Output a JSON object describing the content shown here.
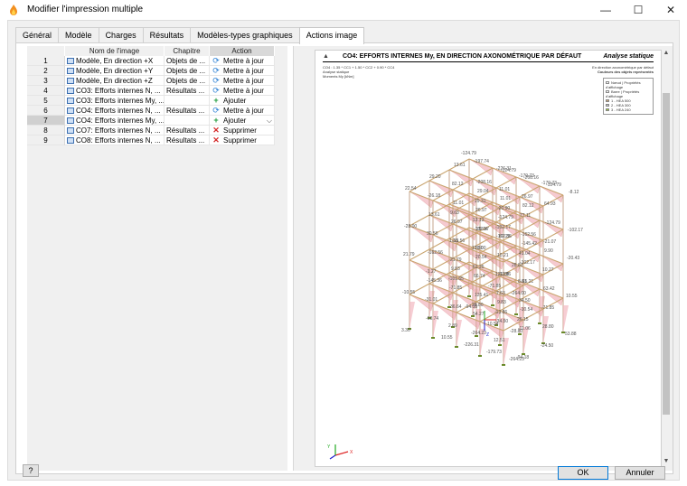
{
  "window": {
    "title": "Modifier l'impression multiple",
    "minimize": "—",
    "maximize": "☐",
    "close": "✕"
  },
  "tabs": [
    {
      "label": "Général"
    },
    {
      "label": "Modèle"
    },
    {
      "label": "Charges"
    },
    {
      "label": "Résultats"
    },
    {
      "label": "Modèles-types graphiques"
    },
    {
      "label": "Actions image"
    }
  ],
  "active_tab": "Actions image",
  "table": {
    "headers": {
      "num": "",
      "name": "Nom de l'image",
      "chapter": "Chapitre",
      "action": "Action"
    },
    "rows": [
      {
        "num": "1",
        "name": "Modèle, En direction +X",
        "chapter": "Objets de ...",
        "action": "Mettre à jour",
        "icon": "refresh-icon"
      },
      {
        "num": "2",
        "name": "Modèle, En direction +Y",
        "chapter": "Objets de ...",
        "action": "Mettre à jour",
        "icon": "refresh-icon"
      },
      {
        "num": "3",
        "name": "Modèle, En direction +Z",
        "chapter": "Objets de ...",
        "action": "Mettre à jour",
        "icon": "refresh-icon"
      },
      {
        "num": "4",
        "name": "CO3: Efforts internes N, ...",
        "chapter": "Résultats ...",
        "action": "Mettre à jour",
        "icon": "refresh-icon"
      },
      {
        "num": "5",
        "name": "CO3: Efforts internes My, ...",
        "chapter": "",
        "action": "Ajouter",
        "icon": "add-icon"
      },
      {
        "num": "6",
        "name": "CO4: Efforts internes N, ...",
        "chapter": "Résultats ...",
        "action": "Mettre à jour",
        "icon": "refresh-icon"
      },
      {
        "num": "7",
        "name": "CO4: Efforts internes My, ...",
        "chapter": "",
        "action": "Ajouter",
        "icon": "add-icon"
      },
      {
        "num": "8",
        "name": "CO7: Efforts internes N, ...",
        "chapter": "Résultats ...",
        "action": "Supprimer",
        "icon": "delete-icon"
      },
      {
        "num": "9",
        "name": "CO8: Efforts internes N, ...",
        "chapter": "Résultats ...",
        "action": "Supprimer",
        "icon": "delete-icon"
      }
    ],
    "selected_row": "7"
  },
  "preview": {
    "title": "CO4: EFFORTS INTERNES My, EN DIRECTION AXONOMÉTRIQUE PAR DÉFAUT",
    "analysis": "Analyse statique",
    "info": [
      "CO4 : 1.35 * CC1 + 1.50 * CC2 + 0.90 * CC4",
      "Analyse statique",
      "Moments My [kNm]"
    ],
    "direction": [
      "En direction axonométrique par défaut",
      "Couleurs des objets représentés"
    ],
    "legend": [
      {
        "label": "Nœud | Propriétés d'affichage",
        "color": "#ffffff"
      },
      {
        "label": "Barre | Propriétés d'affichage",
        "color": "#ffffff"
      },
      {
        "label": "1 - HEA 500",
        "color": "#c8a070"
      },
      {
        "label": "2 - HEA 300",
        "color": "#c0c0c0"
      },
      {
        "label": "3 - HEA 240",
        "color": "#9acd32"
      }
    ],
    "value_labels": [
      "-124.79",
      "-124.79",
      "-208.16",
      "-124.79",
      "-8.12",
      "13.61",
      "-208.16",
      "11.01",
      "26.97",
      "64.93",
      "29.20",
      "82.12",
      "29.31",
      "-20.90",
      "77.11",
      "22.54",
      "-26.18",
      "9.63",
      "13.13",
      "-102.17",
      "29.04",
      "11.01",
      "82.12",
      "-124.79",
      "-102.17",
      "11.01",
      "26.97",
      "-124.79",
      "-162.56",
      "-21.07",
      "13.61",
      "26.97",
      "-102.17",
      "-162.56",
      "41.04",
      "-28.00",
      "30.56",
      "1.35",
      "17.30",
      "28.81",
      "29.04",
      "67.25",
      "-145.42",
      "9.90",
      "-20.43",
      "-13.56",
      "28.00",
      "10.21",
      "-102.17",
      "10.27",
      "-162.56",
      "21.79",
      "61.25",
      "121.08",
      "8.91",
      "21.79",
      "-1.27",
      "-101.65",
      "-71.85",
      "-264.00",
      "20.54",
      "-13.86",
      "-65.21",
      "63.42",
      "10.55",
      "9.83",
      "66.74",
      "7.63",
      "34.50",
      "-71.85",
      "-145.36",
      "-71.85",
      "28.80",
      "-13.86",
      "26.15",
      "-10.55",
      "-31.01",
      "-94.18",
      "10.54",
      "-28.80",
      "125.41",
      "9.83",
      "-10.54",
      "28.80",
      "53.88",
      "36.64",
      "54.27",
      "-34.50",
      "-11.06",
      "-24.50",
      "-68.74",
      "2.89",
      "-264.23",
      "12.51",
      "-94.18",
      "3.30",
      "10.55",
      "-226.31",
      "-179.73",
      "-264.23",
      "-197.74",
      "-226.31",
      "-179.73",
      "-179.73"
    ],
    "axis": {
      "x": "X",
      "y": "Y",
      "z": "Z"
    }
  },
  "buttons": {
    "help": "?",
    "ok": "OK",
    "cancel": "Annuler"
  }
}
